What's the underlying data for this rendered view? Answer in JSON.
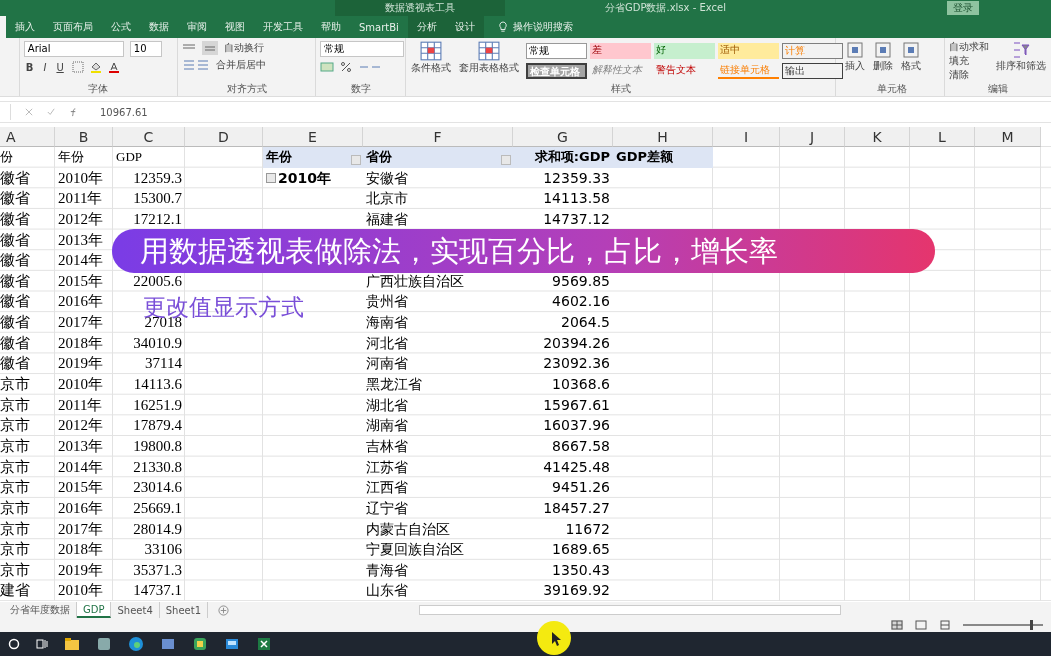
{
  "title_bar": {
    "context_title": "数据透视表工具",
    "file_title": "分省GDP数据.xlsx - Excel",
    "login": "登录"
  },
  "ribbon_tabs": [
    {
      "label": "插入",
      "contextual": false
    },
    {
      "label": "页面布局",
      "contextual": false
    },
    {
      "label": "公式",
      "contextual": false
    },
    {
      "label": "数据",
      "contextual": false
    },
    {
      "label": "审阅",
      "contextual": false
    },
    {
      "label": "视图",
      "contextual": false
    },
    {
      "label": "开发工具",
      "contextual": false
    },
    {
      "label": "帮助",
      "contextual": false
    },
    {
      "label": "SmartBi",
      "contextual": false
    },
    {
      "label": "分析",
      "contextual": true
    },
    {
      "label": "设计",
      "contextual": true
    }
  ],
  "search_hint": "操作说明搜索",
  "font": {
    "name": "Arial",
    "size": "10"
  },
  "font_buttons": [
    "B",
    "I",
    "U"
  ],
  "alignment": [
    "自动换行",
    "合并后居中"
  ],
  "number_format": "常规",
  "style_buttons": [
    "条件格式",
    "套用表格格式"
  ],
  "styles": [
    {
      "label": "常规",
      "kind": "normal"
    },
    {
      "label": "差",
      "kind": "bad"
    },
    {
      "label": "好",
      "kind": "good"
    },
    {
      "label": "适中",
      "kind": "neutral"
    },
    {
      "label": "计算",
      "kind": "calc"
    },
    {
      "label": "检查单元格",
      "kind": "check"
    },
    {
      "label": "解释性文本",
      "kind": "explanatory"
    },
    {
      "label": "警告文本",
      "kind": "warning"
    },
    {
      "label": "链接单元格",
      "kind": "linked"
    },
    {
      "label": "输出",
      "kind": "output"
    }
  ],
  "cell_buttons": [
    "插入",
    "删除",
    "格式"
  ],
  "editing": [
    "自动求和",
    "填充",
    "清除"
  ],
  "sort_filter": "排序和筛选",
  "groups": [
    "字体",
    "对齐方式",
    "数字",
    "样式",
    "单元格",
    "编辑"
  ],
  "formula_bar": {
    "value": "10967.61"
  },
  "columns": [
    "A",
    "B",
    "C",
    "D",
    "E",
    "F",
    "G",
    "H",
    "I",
    "J",
    "K",
    "L",
    "M"
  ],
  "rows": [
    {
      "kind": "header",
      "a": "份",
      "b": "年份",
      "c": "GDP",
      "e": "年份",
      "f": "省份",
      "g": "求和项:GDP",
      "h": "GDP差额"
    },
    {
      "kind": "data",
      "a": "徽省",
      "b": "2010年",
      "c": "12359.3",
      "e": "2010年",
      "f": "安徽省",
      "g": "12359.33"
    },
    {
      "kind": "data",
      "a": "徽省",
      "b": "2011年",
      "c": "15300.7",
      "f": "北京市",
      "g": "14113.58"
    },
    {
      "kind": "data",
      "a": "徽省",
      "b": "2012年",
      "c": "17212.1",
      "f": "福建省",
      "g": "14737.12"
    },
    {
      "kind": "data",
      "a": "徽省",
      "b": "2013年"
    },
    {
      "kind": "data",
      "a": "徽省",
      "b": "2014年"
    },
    {
      "kind": "data",
      "a": "徽省",
      "b": "2015年",
      "c": "22005.6",
      "f": "广西壮族自治区",
      "g": "9569.85"
    },
    {
      "kind": "data",
      "a": "徽省",
      "b": "2016年",
      "f": "贵州省",
      "g": "4602.16"
    },
    {
      "kind": "data",
      "a": "徽省",
      "b": "2017年",
      "c": "27018",
      "f": "海南省",
      "g": "2064.5"
    },
    {
      "kind": "data",
      "a": "徽省",
      "b": "2018年",
      "c": "34010.9",
      "f": "河北省",
      "g": "20394.26"
    },
    {
      "kind": "data",
      "a": "徽省",
      "b": "2019年",
      "c": "37114",
      "f": "河南省",
      "g": "23092.36"
    },
    {
      "kind": "data",
      "a": "京市",
      "b": "2010年",
      "c": "14113.6",
      "f": "黑龙江省",
      "g": "10368.6"
    },
    {
      "kind": "data",
      "a": "京市",
      "b": "2011年",
      "c": "16251.9",
      "f": "湖北省",
      "g": "15967.61"
    },
    {
      "kind": "data",
      "a": "京市",
      "b": "2012年",
      "c": "17879.4",
      "f": "湖南省",
      "g": "16037.96"
    },
    {
      "kind": "data",
      "a": "京市",
      "b": "2013年",
      "c": "19800.8",
      "f": "吉林省",
      "g": "8667.58"
    },
    {
      "kind": "data",
      "a": "京市",
      "b": "2014年",
      "c": "21330.8",
      "f": "江苏省",
      "g": "41425.48"
    },
    {
      "kind": "data",
      "a": "京市",
      "b": "2015年",
      "c": "23014.6",
      "f": "江西省",
      "g": "9451.26"
    },
    {
      "kind": "data",
      "a": "京市",
      "b": "2016年",
      "c": "25669.1",
      "f": "辽宁省",
      "g": "18457.27"
    },
    {
      "kind": "data",
      "a": "京市",
      "b": "2017年",
      "c": "28014.9",
      "f": "内蒙古自治区",
      "g": "11672"
    },
    {
      "kind": "data",
      "a": "京市",
      "b": "2018年",
      "c": "33106",
      "f": "宁夏回族自治区",
      "g": "1689.65"
    },
    {
      "kind": "data",
      "a": "京市",
      "b": "2019年",
      "c": "35371.3",
      "f": "青海省",
      "g": "1350.43"
    },
    {
      "kind": "data",
      "a": "建省",
      "b": "2010年",
      "c": "14737.1",
      "f": "山东省",
      "g": "39169.92"
    }
  ],
  "captions": {
    "title": "用数据透视表做除法，实现百分比，占比，增长率",
    "subtitle": "更改值显示方式"
  },
  "zoom_slider": {
    "level": 0.85
  },
  "sheet_tabs": [
    {
      "label": "分省年度数据",
      "selected": false
    },
    {
      "label": "GDP",
      "selected": true
    },
    {
      "label": "Sheet4",
      "selected": false
    },
    {
      "label": "Sheet1",
      "selected": false
    }
  ]
}
